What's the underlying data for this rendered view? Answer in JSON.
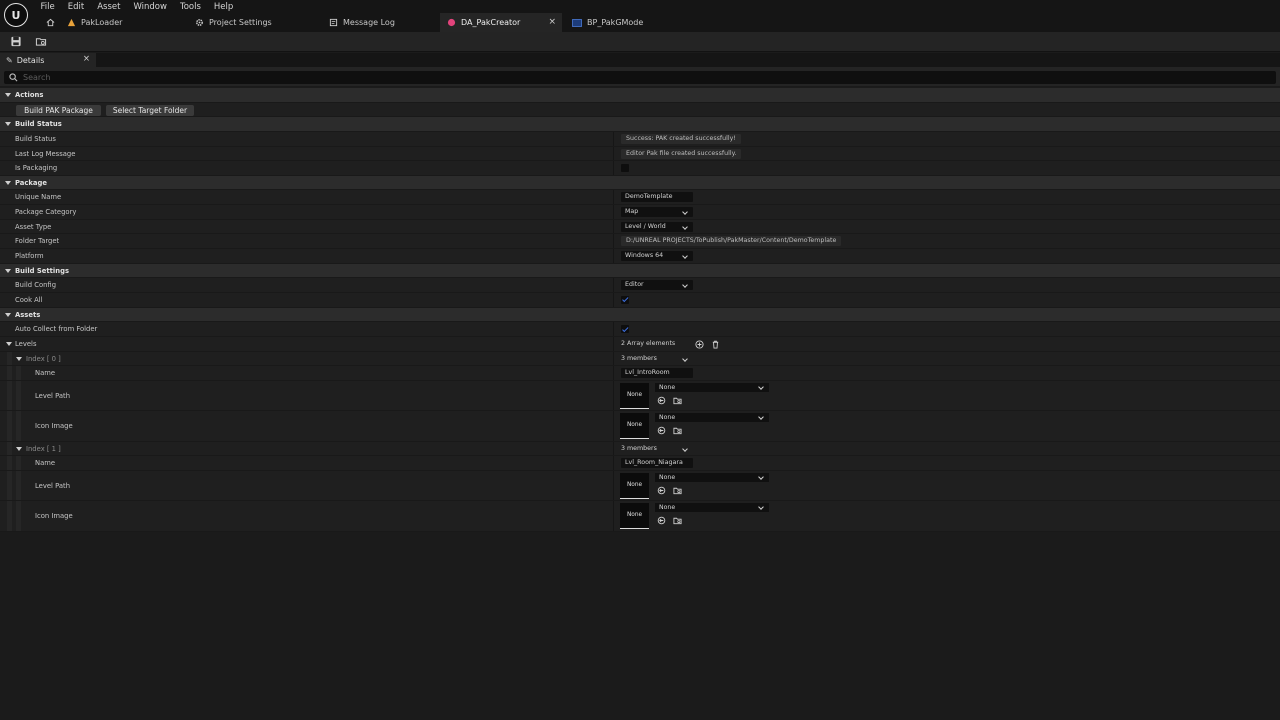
{
  "menu": [
    "File",
    "Edit",
    "Asset",
    "Window",
    "Tools",
    "Help"
  ],
  "tabs": [
    {
      "label": "PakLoader",
      "icon": "map-icon"
    },
    {
      "label": "Project Settings",
      "icon": "gear-icon"
    },
    {
      "label": "Message Log",
      "icon": "message-log-icon"
    },
    {
      "label": "DA_PakCreator",
      "icon": "data-asset-icon",
      "active": true
    },
    {
      "label": "BP_PakGMode",
      "icon": "blueprint-icon"
    }
  ],
  "details": {
    "tab_label": "Details",
    "search_placeholder": "Search"
  },
  "sections": {
    "actions": {
      "title": "Actions",
      "build_button": "Build PAK Package",
      "select_folder_button": "Select Target Folder"
    },
    "build_status": {
      "title": "Build Status",
      "build_status_label": "Build Status",
      "build_status_value": "Success: PAK created successfully!",
      "last_log_label": "Last Log Message",
      "last_log_value": "Editor  Pak file created successfully.",
      "is_packaging_label": "Is Packaging",
      "is_packaging": false
    },
    "package": {
      "title": "Package",
      "unique_name_label": "Unique Name",
      "unique_name_value": "DemoTemplate",
      "category_label": "Package Category",
      "category_value": "Map",
      "asset_type_label": "Asset Type",
      "asset_type_value": "Level / World",
      "folder_target_label": "Folder Target",
      "folder_target_value": "D:/UNREAL PROJECTS/ToPublish/PakMaster/Content/DemoTemplate",
      "platform_label": "Platform",
      "platform_value": "Windows 64"
    },
    "build_settings": {
      "title": "Build Settings",
      "build_config_label": "Build Config",
      "build_config_value": "Editor",
      "cook_all_label": "Cook All",
      "cook_all": true
    },
    "assets": {
      "title": "Assets",
      "auto_collect_label": "Auto Collect from Folder",
      "auto_collect": true,
      "levels_label": "Levels",
      "levels_count": "2 Array elements",
      "levels": [
        {
          "index_label": "Index [ 0 ]",
          "members": "3 members",
          "name_label": "Name",
          "name_value": "Lvl_IntroRoom",
          "level_path_label": "Level Path",
          "level_path_thumb": "None",
          "level_path_value": "None",
          "icon_image_label": "Icon Image",
          "icon_image_thumb": "None",
          "icon_image_value": "None"
        },
        {
          "index_label": "Index [ 1 ]",
          "members": "3 members",
          "name_label": "Name",
          "name_value": "Lvl_Room_Niagara",
          "level_path_label": "Level Path",
          "level_path_thumb": "None",
          "level_path_value": "None",
          "icon_image_label": "Icon Image",
          "icon_image_thumb": "None",
          "icon_image_value": "None"
        }
      ]
    }
  },
  "colors": {
    "background": "#1b1b1b",
    "category_row": "#2c2c2c",
    "active_tab": "#252525",
    "checkbox_check": "#3d6fe0",
    "tab_data_asset": "#e2437b",
    "tab_map": "#e8a23a"
  }
}
